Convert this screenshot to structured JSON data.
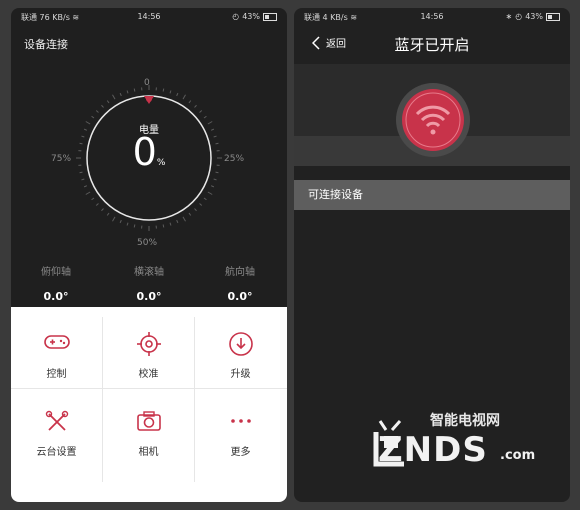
{
  "left_screen": {
    "statusbar": {
      "left": "联通 76 KB/s ≋",
      "time": "14:56",
      "battery": "43%"
    },
    "title": "设备连接",
    "dial": {
      "top_label": "0",
      "left_label": "75%",
      "right_label": "25%",
      "bottom_label": "50%",
      "center_label": "电量",
      "center_value": "0",
      "center_unit": "%"
    },
    "axes": [
      {
        "label": "俯仰轴",
        "value": "0.0°"
      },
      {
        "label": "横滚轴",
        "value": "0.0°"
      },
      {
        "label": "航向轴",
        "value": "0.0°"
      }
    ],
    "grid": [
      {
        "label": "控制",
        "icon": "gamepad-icon"
      },
      {
        "label": "校准",
        "icon": "crosshair-icon"
      },
      {
        "label": "升级",
        "icon": "download-icon"
      },
      {
        "label": "云台设置",
        "icon": "tools-icon"
      },
      {
        "label": "相机",
        "icon": "camera-icon"
      },
      {
        "label": "更多",
        "icon": "more-icon"
      }
    ]
  },
  "right_screen": {
    "statusbar": {
      "left": "联通 4 KB/s ≋",
      "time": "14:56",
      "battery": "43%"
    },
    "back_label": "返回",
    "title": "蓝牙已开启",
    "section_label": "可连接设备"
  },
  "watermark": {
    "cn": "智能电视网",
    "logo": "ZNDS",
    "suffix": ".com"
  },
  "colors": {
    "accent": "#c8334a",
    "dark_bg": "#1f1f1f",
    "panel_bg": "#ffffff"
  }
}
